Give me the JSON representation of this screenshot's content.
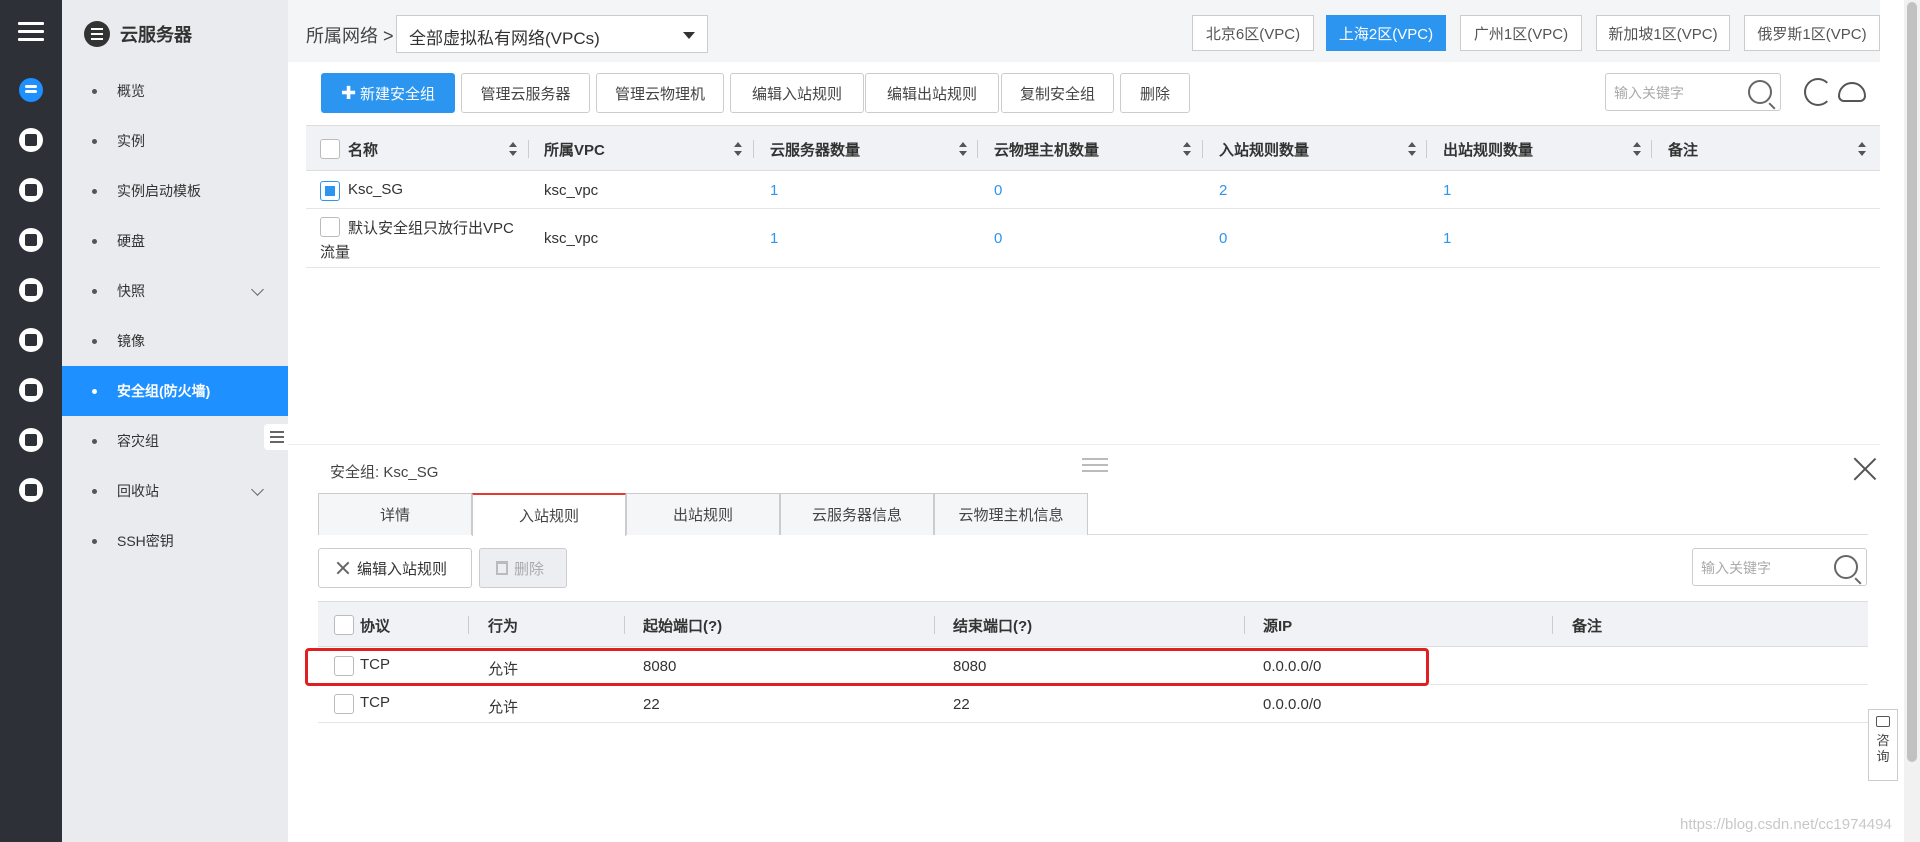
{
  "app": {
    "title": "云服务器"
  },
  "rail": {
    "icons": [
      "menu-icon",
      "server-icon",
      "instance-icon",
      "template-icon",
      "disk-icon",
      "snapshot-icon",
      "image-icon",
      "firewall-icon",
      "disaster-icon",
      "recycle-icon",
      "ssh-key-icon"
    ]
  },
  "sidebar": {
    "items": [
      {
        "label": "概览"
      },
      {
        "label": "实例"
      },
      {
        "label": "实例启动模板"
      },
      {
        "label": "硬盘"
      },
      {
        "label": "快照"
      },
      {
        "label": "镜像"
      },
      {
        "label": "安全组(防火墙)"
      },
      {
        "label": "容灾组"
      },
      {
        "label": "回收站"
      },
      {
        "label": "SSH密钥"
      }
    ],
    "active_index": 6
  },
  "header": {
    "crumb": "所属网络 >",
    "vpc_select": "全部虚拟私有网络(VPCs)",
    "regions": [
      "北京6区(VPC)",
      "上海2区(VPC)",
      "广州1区(VPC)",
      "新加坡1区(VPC)",
      "俄罗斯1区(VPC)"
    ],
    "active_region": "上海2区(VPC)"
  },
  "toolbar": {
    "new_label": "新建安全组",
    "buttons": [
      "管理云服务器",
      "管理云物理机",
      "编辑入站规则",
      "编辑出站规则",
      "复制安全组",
      "删除"
    ],
    "search_placeholder": "输入关键字"
  },
  "sg_table": {
    "columns": [
      "名称",
      "所属VPC",
      "云服务器数量",
      "云物理主机数量",
      "入站规则数量",
      "出站规则数量",
      "备注"
    ],
    "rows": [
      {
        "name": "Ksc_SG",
        "vpc": "ksc_vpc",
        "servers": "1",
        "hosts": "0",
        "inbound": "2",
        "outbound": "1",
        "note": "",
        "checked": true
      },
      {
        "name_line1": "默认安全组只放行出VPC",
        "name_line2": "流量",
        "vpc": "ksc_vpc",
        "servers": "1",
        "hosts": "0",
        "inbound": "0",
        "outbound": "1",
        "note": "",
        "checked": false
      }
    ]
  },
  "detail": {
    "label": "安全组:",
    "sg_name": "Ksc_SG",
    "tabs": [
      "详情",
      "入站规则",
      "出站规则",
      "云服务器信息",
      "云物理主机信息"
    ],
    "active_tab": "入站规则",
    "edit_label": "编辑入站规则",
    "delete_label": "删除",
    "search_placeholder": "输入关键字",
    "columns": [
      "协议",
      "行为",
      "起始端口(?)",
      "结束端口(?)",
      "源IP",
      "备注"
    ],
    "rules": [
      {
        "protocol": "TCP",
        "action": "允许",
        "start": "8080",
        "end": "8080",
        "source": "0.0.0.0/0",
        "note": ""
      },
      {
        "protocol": "TCP",
        "action": "允许",
        "start": "22",
        "end": "22",
        "source": "0.0.0.0/0",
        "note": ""
      }
    ]
  },
  "consult": {
    "line1": "咨",
    "line2": "询"
  },
  "watermark": "https://blog.csdn.net/cc1974494",
  "colors": {
    "accent": "#2b95f0",
    "highlight": "#e02020",
    "rail": "#2d3037",
    "sidebar": "#e9ebee"
  }
}
